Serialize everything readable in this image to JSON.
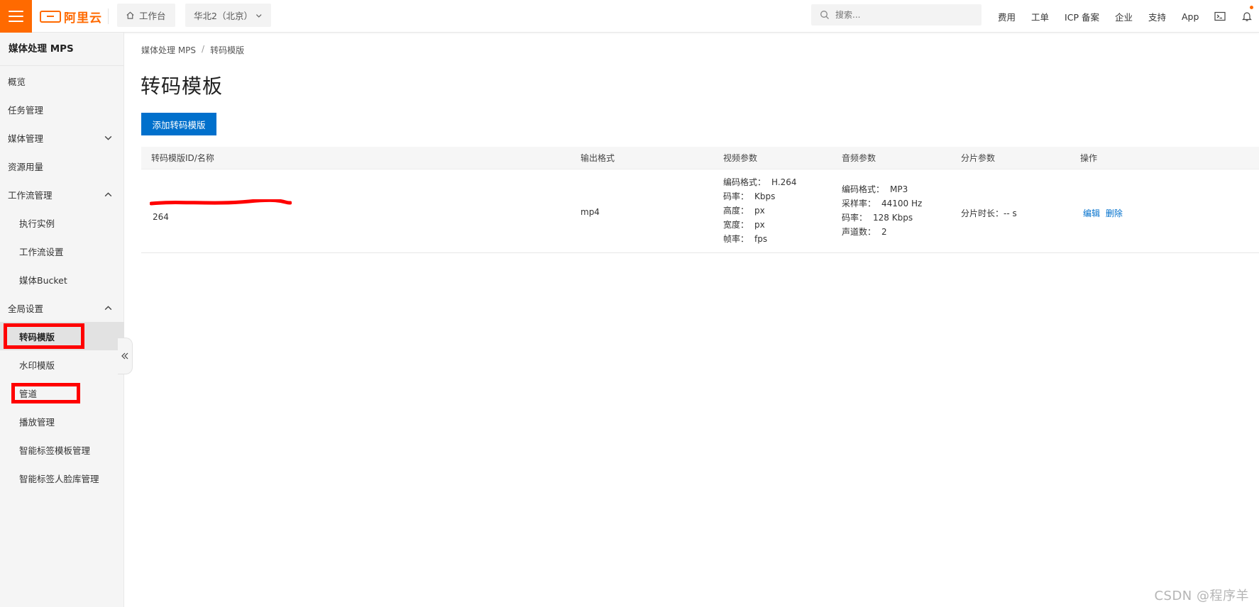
{
  "header": {
    "logo_text": "阿里云",
    "workbench": "工作台",
    "region": "华北2（北京）",
    "search_placeholder": "搜索...",
    "links": [
      "费用",
      "工单",
      "ICP 备案",
      "企业",
      "支持",
      "App"
    ]
  },
  "sidebar": {
    "title": "媒体处理 MPS",
    "items": [
      {
        "label": "概览"
      },
      {
        "label": "任务管理"
      },
      {
        "label": "媒体管理"
      },
      {
        "label": "资源用量"
      },
      {
        "label": "工作流管理"
      },
      {
        "label": "执行实例"
      },
      {
        "label": "工作流设置"
      },
      {
        "label": "媒体Bucket"
      },
      {
        "label": "全局设置"
      },
      {
        "label": "转码模版"
      },
      {
        "label": "水印模版"
      },
      {
        "label": "管道"
      },
      {
        "label": "播放管理"
      },
      {
        "label": "智能标签模板管理"
      },
      {
        "label": "智能标签人脸库管理"
      }
    ]
  },
  "breadcrumb": {
    "root": "媒体处理 MPS",
    "separator": "/",
    "current": "转码模版"
  },
  "page_title": "转码模板",
  "add_button": "添加转码模版",
  "table": {
    "headers": [
      "转码模版ID/名称",
      "输出格式",
      "视频参数",
      "音频参数",
      "分片参数",
      "操作"
    ],
    "row": {
      "name": "264",
      "format": "mp4",
      "video": [
        {
          "label": "编码格式：",
          "value": "H.264"
        },
        {
          "label": "码率：",
          "value": "Kbps"
        },
        {
          "label": "高度：",
          "value": "px"
        },
        {
          "label": "宽度：",
          "value": "px"
        },
        {
          "label": "帧率：",
          "value": "fps"
        }
      ],
      "audio": [
        {
          "label": "编码格式：",
          "value": "MP3"
        },
        {
          "label": "采样率：",
          "value": "44100 Hz"
        },
        {
          "label": "码率：",
          "value": "128 Kbps"
        },
        {
          "label": "声道数：",
          "value": "2"
        }
      ],
      "segment": "分片时长：-- s",
      "ops": [
        "编辑",
        "删除"
      ]
    }
  },
  "watermark": "CSDN @程序羊",
  "colors": {
    "brand": "#ff6a00",
    "primary": "#0070cc",
    "highlight": "#ff0000"
  }
}
